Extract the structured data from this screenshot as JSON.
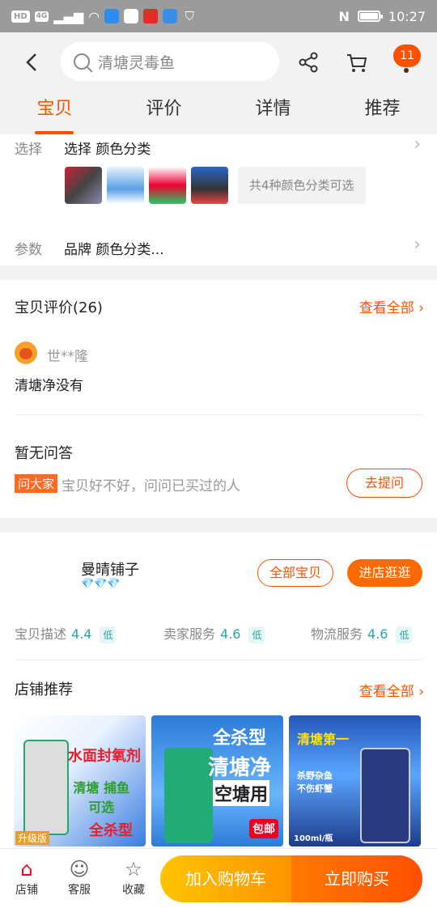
{
  "status_bar": {
    "network": "HD",
    "signal": "4G",
    "time": "10:27",
    "nfc": "N"
  },
  "header": {
    "search_placeholder": "清塘灵毒鱼",
    "cart_badge": "11",
    "tabs": [
      {
        "label": "宝贝",
        "active": true
      },
      {
        "label": "评价",
        "active": false
      },
      {
        "label": "详情",
        "active": false
      },
      {
        "label": "推荐",
        "active": false
      }
    ]
  },
  "selection": {
    "label": "选择",
    "value": "选择 颜色分类",
    "variants_more": "共4种颜色分类可选",
    "params_label": "参数",
    "params_value": "品牌 颜色分类..."
  },
  "reviews": {
    "title": "宝贝评价(26)",
    "view_all": "查看全部",
    "reviewer": "世**隆",
    "review_text": "清塘净没有"
  },
  "qa": {
    "title": "暂无问答",
    "tag": "问大家",
    "prompt": "宝贝好不好，问问已买过的人",
    "ask_button": "去提问"
  },
  "shop": {
    "name": "曼晴铺子",
    "diamonds": "💎💎💎",
    "all_items_button": "全部宝贝",
    "visit_button": "进店逛逛",
    "ratings": [
      {
        "label": "宝贝描述",
        "score": "4.4",
        "level": "低"
      },
      {
        "label": "卖家服务",
        "score": "4.6",
        "level": "低"
      },
      {
        "label": "物流服务",
        "score": "4.6",
        "level": "低"
      }
    ],
    "recommend_title": "店铺推荐",
    "recommend_more": "查看全部",
    "recommend_items": [
      {
        "cap_a": "水面封氧剂",
        "cap_b": "清塘 捕鱼\n可选",
        "cap_c": "全杀型",
        "tag": "升级版"
      },
      {
        "cap_a": "全杀型",
        "cap_b": "清塘净",
        "cap_c": "空塘用",
        "cap_d": "包邮"
      },
      {
        "cap_a": "清塘第一",
        "cap_b": "杀野杂鱼\n不伤虾蟹",
        "cap_d": "100ml/瓶"
      }
    ]
  },
  "bottom_bar": {
    "shop_label": "店铺",
    "service_label": "客服",
    "favorite_label": "收藏",
    "add_to_cart": "加入购物车",
    "buy_now": "立即购买"
  }
}
